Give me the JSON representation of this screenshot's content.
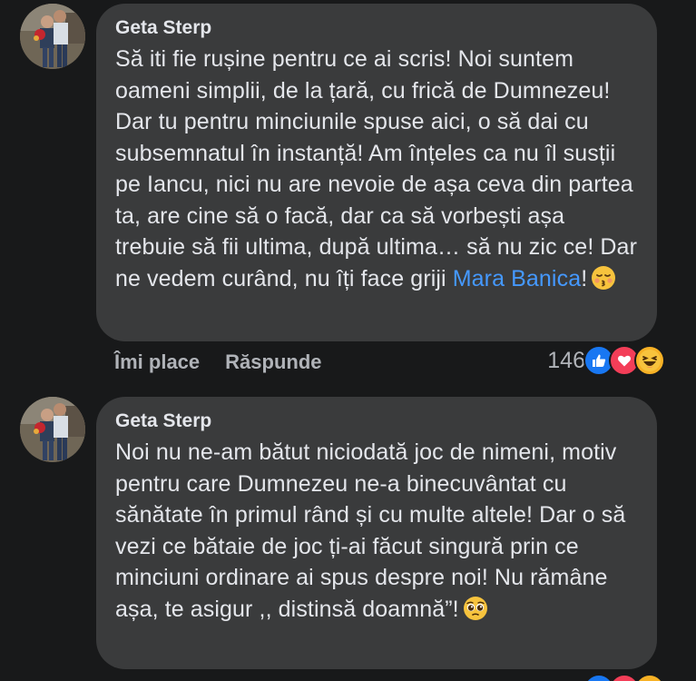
{
  "comments": [
    {
      "author": "Geta Sterp",
      "text_before_mention": "Să iti fie rușine pentru ce ai scris! Noi suntem oameni simplii, de la țară, cu frică de Dumnezeu! Dar tu pentru minciunile spuse aici, o să dai cu subsemnatul în instanță! Am înțeles ca nu îl susții pe Iancu, nici nu are nevoie de așa ceva din partea ta, are cine să o facă, dar ca să vorbești așa trebuie să fii ultima, după ultima… să nu zic ce! Dar ne vedem curând, nu îți face griji ",
      "mention": "Mara Banica",
      "text_after_mention": "!",
      "emoji": "kissing-face-with-closed-eyes",
      "like_label": "Îmi place",
      "reply_label": "Răspunde",
      "reaction_count": "146",
      "reactions": [
        "like",
        "love",
        "haha"
      ]
    },
    {
      "author": "Geta Sterp",
      "text": "Noi nu ne-am bătut niciodată joc de nimeni, motiv pentru care Dumnezeu ne-a binecuvântat cu sănătate în primul rând și cu multe altele! Dar o să vezi ce bătaie de joc ți-ai făcut singură prin ce minciuni ordinare ai spus despre noi! Nu rămâne așa, te asigur ,, distinsă doamnă”!",
      "emoji": "pleading-face"
    }
  ],
  "colors": {
    "background": "#18191a",
    "bubble": "#3a3b3c",
    "text": "#e4e6eb",
    "secondary_text": "#b0b3b8",
    "mention": "#4599ff",
    "like": "#1877f2",
    "love": "#f33e58",
    "haha": "#f7b125"
  }
}
